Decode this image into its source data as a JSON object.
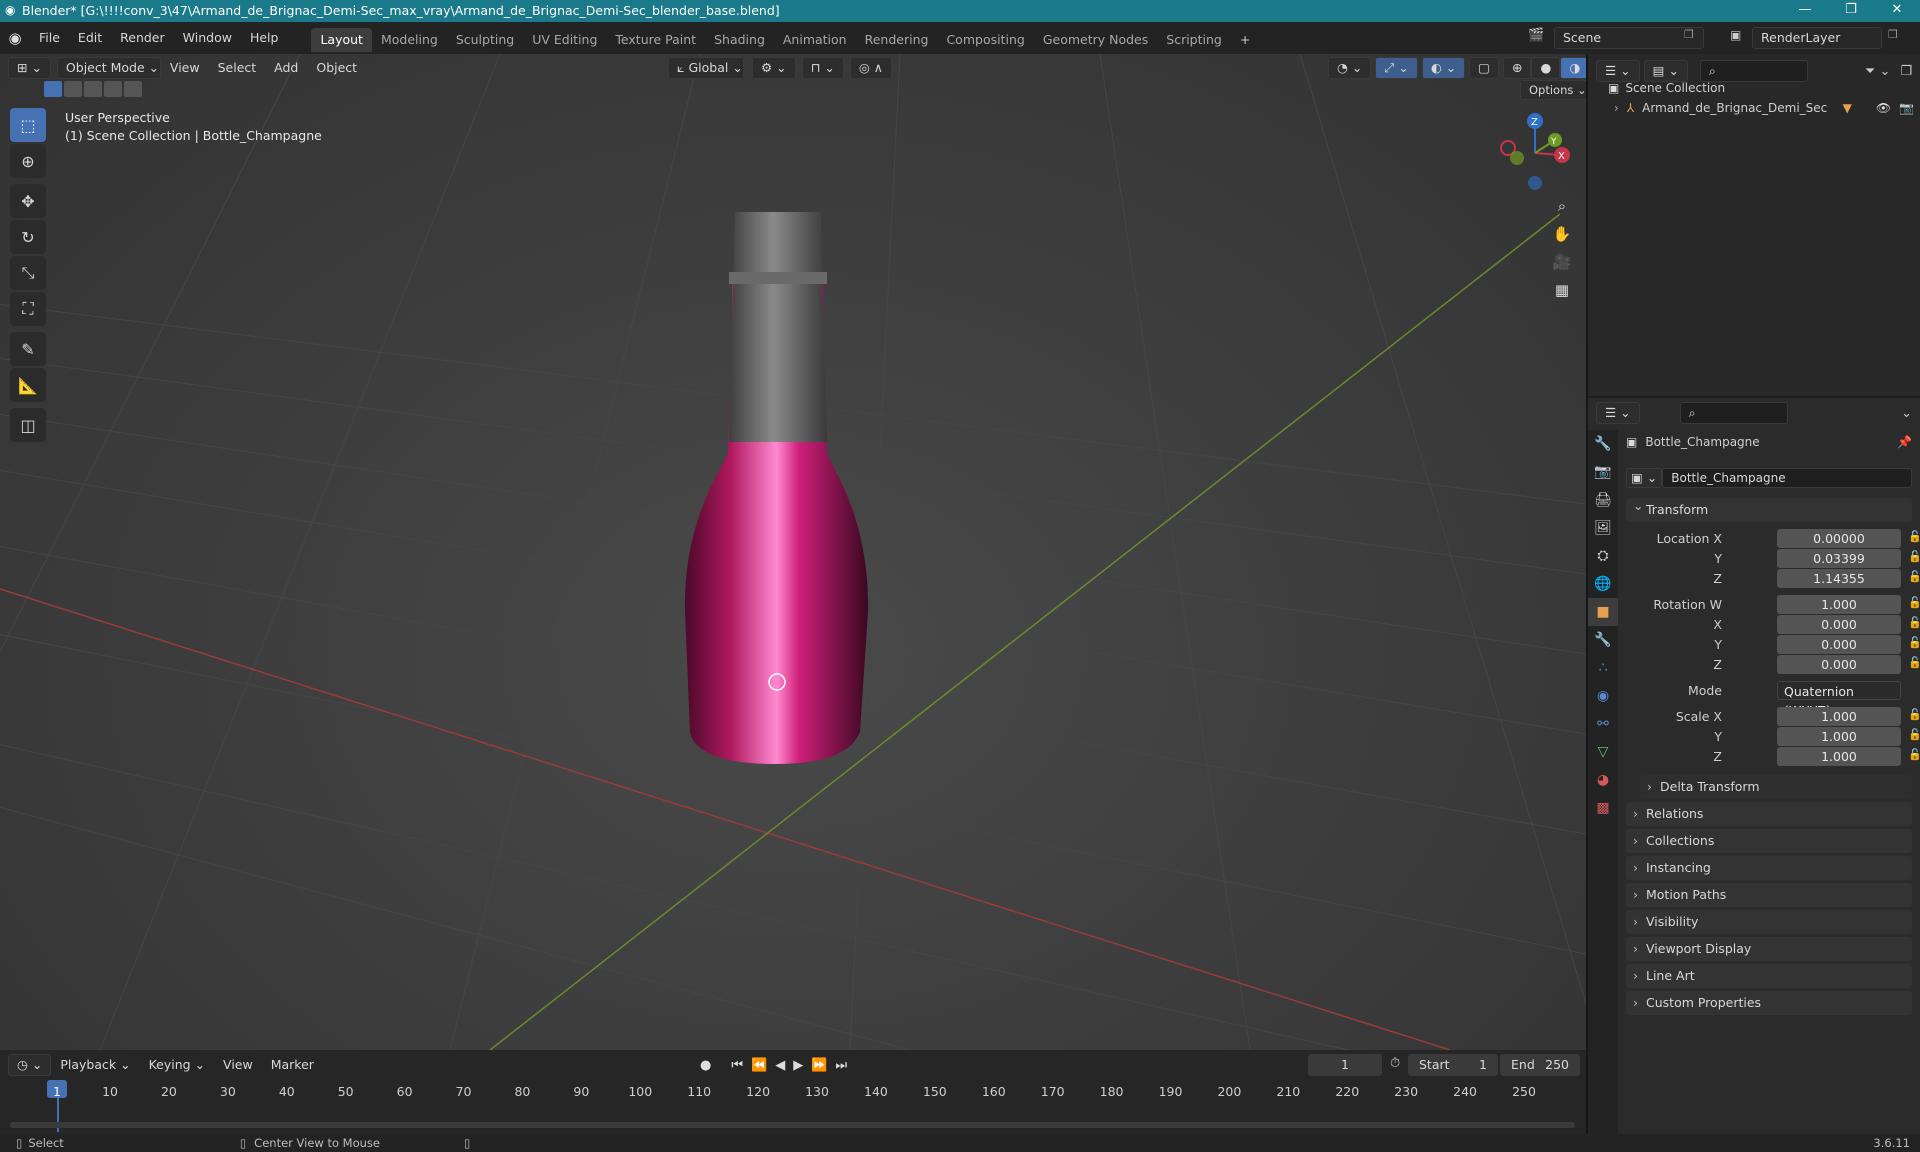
{
  "window": {
    "title": "Blender* [G:\\!!!!conv_3\\47\\Armand_de_Brignac_Demi-Sec_max_vray\\Armand_de_Brignac_Demi-Sec_blender_base.blend]",
    "minimize": "—",
    "maximize": "❐",
    "close": "✕"
  },
  "menu": [
    "File",
    "Edit",
    "Render",
    "Window",
    "Help"
  ],
  "workspaces": [
    "Layout",
    "Modeling",
    "Sculpting",
    "UV Editing",
    "Texture Paint",
    "Shading",
    "Animation",
    "Rendering",
    "Compositing",
    "Geometry Nodes",
    "Scripting"
  ],
  "add_workspace": "+",
  "scene": {
    "name": "Scene",
    "view_layer": "RenderLayer"
  },
  "viewport": {
    "mode": "Object Mode",
    "menus": [
      "View",
      "Select",
      "Add",
      "Object"
    ],
    "orientation": "Global",
    "options_label": "Options",
    "perspective": "User Perspective",
    "collection_path": "(1) Scene Collection | Bottle_Champagne",
    "gizmo": {
      "z": "Z",
      "y": "Y",
      "x": "X"
    }
  },
  "outliner": {
    "root": "Scene Collection",
    "items": [
      {
        "name": "Armand_de_Brignac_Demi_Sec"
      }
    ]
  },
  "properties": {
    "object_name": "Bottle_Champagne",
    "data_name": "Bottle_Champagne",
    "transform_label": "Transform",
    "location": {
      "label": "Location X",
      "x": "0.00000",
      "y": "0.03399",
      "z": "1.14355"
    },
    "rotation": {
      "label": "Rotation W",
      "w": "1.000",
      "x": "0.000",
      "y": "0.000",
      "z": "0.000"
    },
    "mode": {
      "label": "Mode",
      "value": "Quaternion (WXYZ)"
    },
    "scale": {
      "label": "Scale X",
      "x": "1.000",
      "y": "1.000",
      "z": "1.000"
    },
    "axis_labels": {
      "x": "X",
      "y": "Y",
      "z": "Z"
    },
    "delta": "Delta Transform",
    "sections": [
      "Relations",
      "Collections",
      "Instancing",
      "Motion Paths",
      "Visibility",
      "Viewport Display",
      "Line Art",
      "Custom Properties"
    ]
  },
  "timeline": {
    "menus": [
      "Playback",
      "Keying",
      "View",
      "Marker"
    ],
    "current_frame": "1",
    "start_label": "Start",
    "start": "1",
    "end_label": "End",
    "end": "250",
    "ticks": [
      "1",
      "10",
      "20",
      "30",
      "40",
      "50",
      "60",
      "70",
      "80",
      "90",
      "100",
      "110",
      "120",
      "130",
      "140",
      "150",
      "160",
      "170",
      "180",
      "190",
      "200",
      "210",
      "220",
      "230",
      "240",
      "250"
    ]
  },
  "status": {
    "left": "Select",
    "middle": "Center View to Mouse",
    "version": "3.6.11"
  }
}
